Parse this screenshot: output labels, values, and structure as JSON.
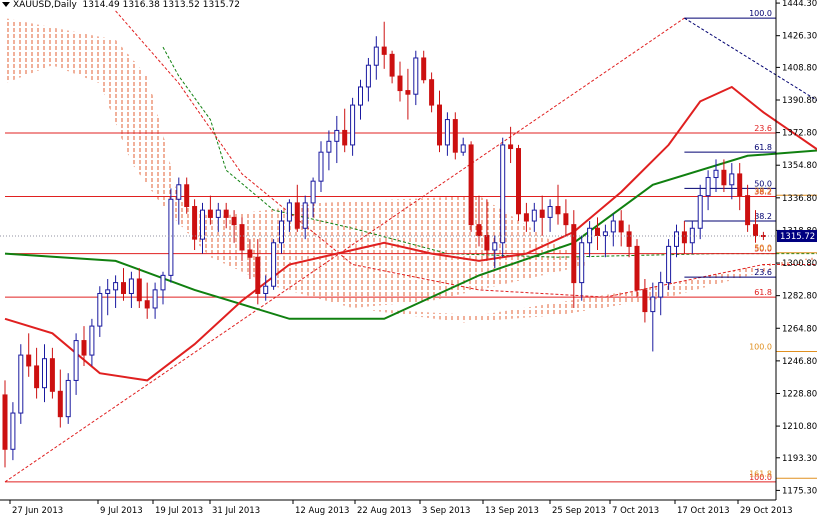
{
  "header": {
    "symbol": "XAUUSD,Daily",
    "ohlc": "1314.49 1316.38 1313.52 1315.72"
  },
  "chart_data": {
    "type": "candlestick",
    "symbol": "XAUUSD",
    "timeframe": "Daily",
    "current_price": "1315.72",
    "ylim": [
      1170.0,
      1446.0
    ],
    "grid": false,
    "colors": {
      "bull_candle": "#1a1aa0",
      "bear_candle": "#cc1010",
      "tenkan": "#e02020",
      "kijun": "#108010",
      "cloud_bull": "#30a030",
      "cloud_bear": "#e05020",
      "fib_red": "#e02020",
      "fib_navy": "#000070",
      "fib_orange": "#e09020",
      "price_tag": "#000080"
    },
    "y_ticks": [
      "1444.30",
      "1426.30",
      "1408.80",
      "1390.80",
      "1372.80",
      "1354.80",
      "1336.80",
      "1318.80",
      "1300.80",
      "1282.80",
      "1264.80",
      "1246.80",
      "1228.80",
      "1210.80",
      "1193.30",
      "1175.30"
    ],
    "x_ticks": [
      "27 Jun 2013",
      "9 Jul 2013",
      "19 Jul 2013",
      "31 Jul 2013",
      "12 Aug 2013",
      "22 Aug 2013",
      "3 Sep 2013",
      "13 Sep 2013",
      "25 Sep 2013",
      "7 Oct 2013",
      "17 Oct 2013",
      "29 Oct 2013"
    ],
    "candles": [
      [
        1228,
        1236,
        1188,
        1198
      ],
      [
        1198,
        1224,
        1192,
        1218
      ],
      [
        1218,
        1256,
        1212,
        1250
      ],
      [
        1250,
        1262,
        1238,
        1244
      ],
      [
        1244,
        1254,
        1226,
        1232
      ],
      [
        1232,
        1256,
        1224,
        1248
      ],
      [
        1248,
        1254,
        1226,
        1230
      ],
      [
        1230,
        1242,
        1210,
        1216
      ],
      [
        1216,
        1240,
        1212,
        1236
      ],
      [
        1236,
        1262,
        1228,
        1258
      ],
      [
        1258,
        1266,
        1244,
        1250
      ],
      [
        1250,
        1270,
        1244,
        1266
      ],
      [
        1266,
        1288,
        1260,
        1284
      ],
      [
        1284,
        1292,
        1272,
        1286
      ],
      [
        1286,
        1294,
        1276,
        1290
      ],
      [
        1290,
        1298,
        1280,
        1284
      ],
      [
        1284,
        1296,
        1276,
        1292
      ],
      [
        1292,
        1298,
        1276,
        1280
      ],
      [
        1280,
        1290,
        1270,
        1276
      ],
      [
        1276,
        1290,
        1270,
        1286
      ],
      [
        1286,
        1296,
        1278,
        1294
      ],
      [
        1294,
        1342,
        1290,
        1336
      ],
      [
        1336,
        1348,
        1322,
        1344
      ],
      [
        1344,
        1348,
        1328,
        1332
      ],
      [
        1332,
        1336,
        1308,
        1314
      ],
      [
        1314,
        1334,
        1306,
        1330
      ],
      [
        1330,
        1338,
        1322,
        1326
      ],
      [
        1326,
        1334,
        1318,
        1330
      ],
      [
        1330,
        1334,
        1320,
        1326
      ],
      [
        1326,
        1330,
        1312,
        1322
      ],
      [
        1322,
        1326,
        1302,
        1308
      ],
      [
        1308,
        1314,
        1292,
        1304
      ],
      [
        1304,
        1314,
        1278,
        1284
      ],
      [
        1284,
        1294,
        1280,
        1288
      ],
      [
        1288,
        1314,
        1286,
        1312
      ],
      [
        1312,
        1330,
        1306,
        1324
      ],
      [
        1324,
        1336,
        1318,
        1334
      ],
      [
        1334,
        1344,
        1318,
        1320
      ],
      [
        1320,
        1338,
        1314,
        1334
      ],
      [
        1334,
        1348,
        1326,
        1346
      ],
      [
        1346,
        1368,
        1340,
        1362
      ],
      [
        1362,
        1374,
        1352,
        1368
      ],
      [
        1368,
        1382,
        1356,
        1374
      ],
      [
        1374,
        1386,
        1362,
        1366
      ],
      [
        1366,
        1392,
        1360,
        1388
      ],
      [
        1388,
        1402,
        1380,
        1398
      ],
      [
        1398,
        1414,
        1390,
        1410
      ],
      [
        1410,
        1426,
        1402,
        1420
      ],
      [
        1420,
        1434,
        1408,
        1416
      ],
      [
        1416,
        1418,
        1400,
        1404
      ],
      [
        1404,
        1412,
        1390,
        1396
      ],
      [
        1396,
        1408,
        1380,
        1394
      ],
      [
        1394,
        1418,
        1388,
        1414
      ],
      [
        1414,
        1418,
        1400,
        1402
      ],
      [
        1402,
        1406,
        1384,
        1388
      ],
      [
        1388,
        1396,
        1362,
        1366
      ],
      [
        1366,
        1384,
        1360,
        1380
      ],
      [
        1380,
        1384,
        1358,
        1362
      ],
      [
        1362,
        1370,
        1360,
        1366
      ],
      [
        1366,
        1368,
        1318,
        1322
      ],
      [
        1322,
        1338,
        1310,
        1316
      ],
      [
        1316,
        1336,
        1302,
        1308
      ],
      [
        1308,
        1316,
        1298,
        1312
      ],
      [
        1312,
        1370,
        1304,
        1366
      ],
      [
        1366,
        1376,
        1356,
        1364
      ],
      [
        1364,
        1366,
        1324,
        1328
      ],
      [
        1328,
        1334,
        1318,
        1324
      ],
      [
        1324,
        1334,
        1318,
        1330
      ],
      [
        1330,
        1338,
        1316,
        1326
      ],
      [
        1326,
        1336,
        1318,
        1332
      ],
      [
        1332,
        1344,
        1322,
        1328
      ],
      [
        1328,
        1336,
        1316,
        1322
      ],
      [
        1322,
        1330,
        1276,
        1290
      ],
      [
        1290,
        1316,
        1280,
        1312
      ],
      [
        1312,
        1324,
        1304,
        1320
      ],
      [
        1320,
        1326,
        1308,
        1316
      ],
      [
        1316,
        1322,
        1304,
        1318
      ],
      [
        1318,
        1328,
        1310,
        1324
      ],
      [
        1324,
        1330,
        1310,
        1318
      ],
      [
        1318,
        1322,
        1304,
        1310
      ],
      [
        1310,
        1314,
        1282,
        1286
      ],
      [
        1286,
        1292,
        1268,
        1274
      ],
      [
        1274,
        1290,
        1252,
        1282
      ],
      [
        1282,
        1296,
        1272,
        1290
      ],
      [
        1290,
        1314,
        1286,
        1310
      ],
      [
        1310,
        1322,
        1304,
        1318
      ],
      [
        1318,
        1324,
        1306,
        1312
      ],
      [
        1312,
        1324,
        1306,
        1320
      ],
      [
        1320,
        1344,
        1314,
        1338
      ],
      [
        1338,
        1352,
        1330,
        1348
      ],
      [
        1348,
        1358,
        1340,
        1352
      ],
      [
        1352,
        1358,
        1340,
        1344
      ],
      [
        1344,
        1356,
        1336,
        1350
      ],
      [
        1350,
        1356,
        1330,
        1338
      ],
      [
        1338,
        1344,
        1318,
        1322
      ],
      [
        1322,
        1330,
        1312,
        1316
      ],
      [
        1316,
        1318,
        1313.5,
        1315.7
      ]
    ],
    "tenkan_sen": [
      [
        0,
        1270
      ],
      [
        6,
        1262
      ],
      [
        12,
        1240
      ],
      [
        18,
        1236
      ],
      [
        24,
        1256
      ],
      [
        30,
        1280
      ],
      [
        36,
        1300
      ],
      [
        42,
        1306
      ],
      [
        48,
        1312
      ],
      [
        54,
        1306
      ],
      [
        60,
        1302
      ],
      [
        66,
        1306
      ],
      [
        72,
        1318
      ],
      [
        78,
        1340
      ],
      [
        84,
        1366
      ],
      [
        88,
        1390
      ],
      [
        92,
        1398
      ],
      [
        96,
        1384
      ],
      [
        100,
        1372
      ],
      [
        106,
        1354
      ],
      [
        110,
        1332
      ],
      [
        116,
        1324
      ],
      [
        122,
        1316
      ],
      [
        128,
        1306
      ],
      [
        134,
        1300
      ],
      [
        140,
        1306
      ],
      [
        146,
        1300
      ],
      [
        152,
        1288
      ],
      [
        158,
        1274
      ],
      [
        164,
        1300
      ],
      [
        170,
        1306
      ],
      [
        176,
        1322
      ],
      [
        182,
        1334
      ],
      [
        188,
        1338
      ],
      [
        196,
        1336
      ]
    ],
    "kijun_sen": [
      [
        0,
        1306
      ],
      [
        14,
        1302
      ],
      [
        24,
        1286
      ],
      [
        36,
        1270
      ],
      [
        48,
        1270
      ],
      [
        60,
        1294
      ],
      [
        72,
        1312
      ],
      [
        82,
        1344
      ],
      [
        94,
        1360
      ],
      [
        106,
        1364
      ],
      [
        114,
        1360
      ],
      [
        124,
        1354
      ],
      [
        134,
        1344
      ],
      [
        142,
        1330
      ],
      [
        152,
        1318
      ],
      [
        164,
        1312
      ],
      [
        176,
        1314
      ],
      [
        188,
        1334
      ],
      [
        196,
        1336
      ]
    ],
    "fibonacci_left": [
      {
        "label": "100.0",
        "value": 1436,
        "color": "navy"
      },
      {
        "label": "23.6",
        "value": 1372.6,
        "color": "red"
      },
      {
        "label": "38.2",
        "value": 1337.5,
        "color": "red"
      },
      {
        "label": "50.0",
        "value": 1306,
        "color": "red"
      },
      {
        "label": "61.8",
        "value": 1282,
        "color": "red"
      },
      {
        "label": "100.0",
        "value": 1180,
        "color": "red"
      }
    ],
    "fibonacci_right": [
      {
        "label": "61.8",
        "value": 1362,
        "color": "navy"
      },
      {
        "label": "50.0",
        "value": 1342,
        "color": "navy"
      },
      {
        "label": "38.2",
        "value": 1324,
        "color": "navy"
      },
      {
        "label": "23.6",
        "value": 1293,
        "color": "navy"
      },
      {
        "label": "100.0",
        "value": 1252,
        "color": "orange"
      },
      {
        "label": "38.2",
        "value": 1338.2,
        "color": "orange"
      },
      {
        "label": "50.0",
        "value": 1306.5,
        "color": "orange"
      },
      {
        "label": "161.8",
        "value": 1182,
        "color": "orange"
      }
    ]
  }
}
